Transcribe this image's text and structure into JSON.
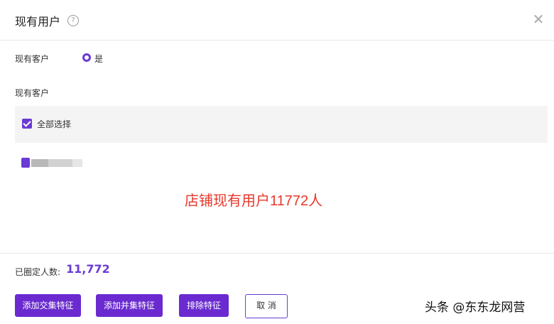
{
  "dialog": {
    "title": "现有用户",
    "help_icon": "question-circle-icon",
    "close_icon": "close-icon"
  },
  "existing_customer_row": {
    "label": "现有客户",
    "radio_label": "是",
    "radio_selected": true
  },
  "customers_section": {
    "label": "现有客户",
    "select_all_label": "全部选择",
    "select_all_checked": true
  },
  "annotation": {
    "text": "店铺现有用户11772人",
    "color": "#e8372a"
  },
  "footer": {
    "count_label": "已圈定人数:",
    "count_value": "11,772",
    "buttons": {
      "add_intersection": "添加交集特征",
      "add_union": "添加并集特征",
      "exclude": "排除特征",
      "cancel": "取 消"
    }
  },
  "watermark": {
    "text": "头条 @东东龙网营"
  },
  "colors": {
    "accent": "#6a2ad0",
    "annotation": "#e8372a"
  }
}
